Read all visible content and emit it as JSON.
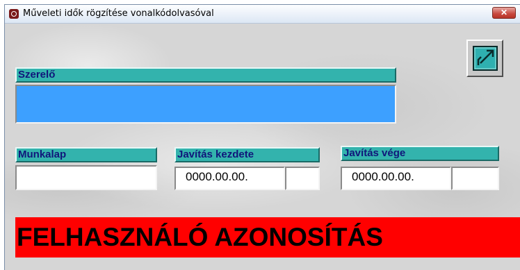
{
  "window": {
    "title": "Műveleti idők rögzítése vonalkódolvasóval",
    "close_label": "✕"
  },
  "form": {
    "mechanic_label": "Szerelő",
    "mechanic_value": "",
    "worksheet_label": "Munkalap",
    "worksheet_value": "",
    "repair_start_label": "Javítás kezdete",
    "repair_start_date": "0000.00.00.",
    "repair_start_time": "",
    "repair_end_label": "Javítás vége",
    "repair_end_date": "0000.00.00.",
    "repair_end_time": ""
  },
  "status_banner": "FELHASZNÁLÓ AZONOSÍTÁS",
  "colors": {
    "label_bg": "#33b3ad",
    "label_text": "#10167a",
    "mechanic_field_bg": "#3da0ff",
    "banner_bg": "#ff0000"
  },
  "icons": {
    "exit": "exit-door-icon",
    "app": "app-icon"
  }
}
